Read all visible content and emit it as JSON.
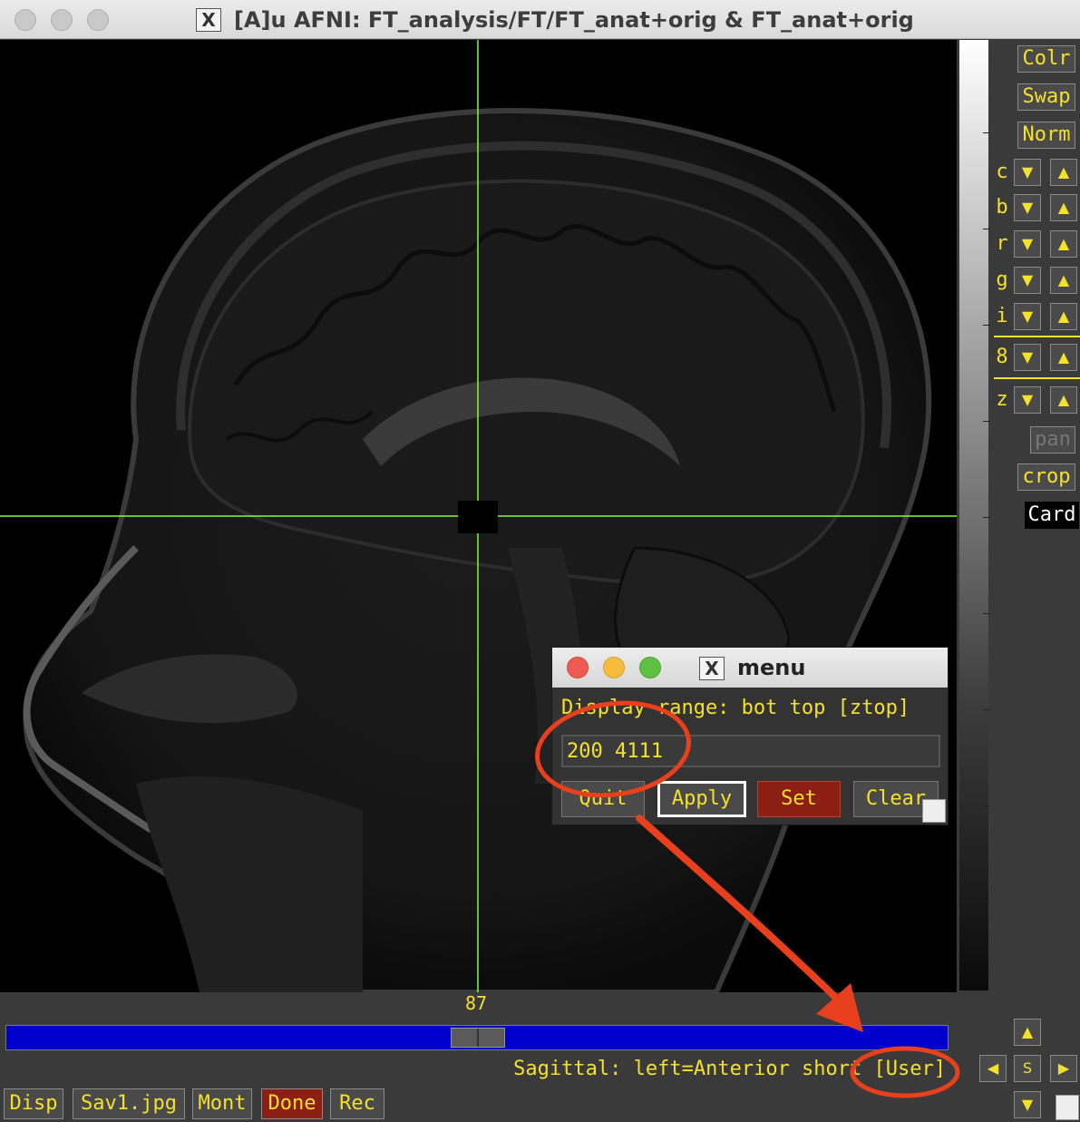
{
  "window": {
    "title": "[A]u AFNI: FT_analysis/FT/FT_anat+orig & FT_anat+orig"
  },
  "colorbar_buttons": {
    "colr": "Colr",
    "swap": "Swap",
    "norm": "Norm",
    "pan": "pan",
    "crop": "crop",
    "card": "Card"
  },
  "adjust_rows": [
    "c",
    "b",
    "r",
    "g",
    "i",
    "8",
    "z"
  ],
  "slice": {
    "number": "87"
  },
  "status": {
    "text": "Sagittal: left=Anterior short [User]"
  },
  "nav": {
    "s_label": "S"
  },
  "bottom_buttons": {
    "disp": "Disp",
    "save": "Sav1.jpg",
    "mont": "Mont",
    "done": "Done",
    "rec": "Rec"
  },
  "popup": {
    "title": "menu",
    "label": "Display range: bot top [ztop]",
    "input_value": "200 4111",
    "quit": "Quit",
    "apply": "Apply",
    "set": "Set",
    "clear": "Clear"
  },
  "colors": {
    "accent_yellow": "#f5e02a",
    "crosshair": "#7fff3a",
    "annotation": "#e8401c",
    "slider_blue": "#0000cc",
    "button_red": "#8c1e14"
  },
  "icons": [
    "x11-icon",
    "down-arrow-icon",
    "up-arrow-icon",
    "left-arrow-icon",
    "right-arrow-icon",
    "resize-grip-icon"
  ]
}
